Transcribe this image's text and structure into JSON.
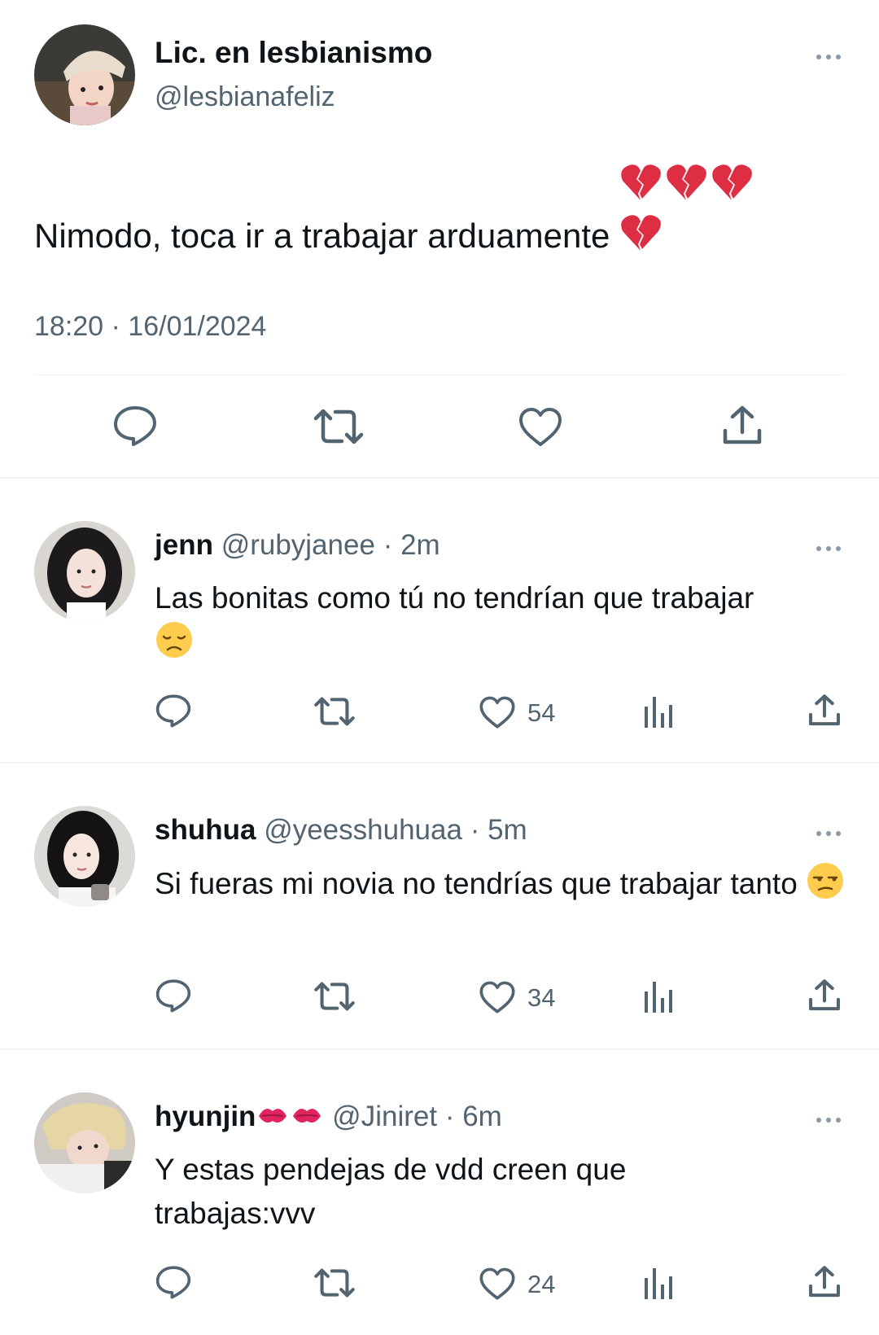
{
  "main_tweet": {
    "display_name": "Lic. en lesbianismo",
    "handle": "@lesbianafeliz",
    "text": "Nimodo, toca ir a trabajar arduamente",
    "emoji": "broken-heart x4",
    "timestamp": "18:20 · 16/01/2024",
    "actions": [
      "reply-icon",
      "retweet-icon",
      "like-icon",
      "share-icon"
    ]
  },
  "replies": [
    {
      "display_name": "jenn",
      "handle": "@rubyjanee",
      "time": "· 2m",
      "text": "Las bonitas como tú no tendrían que trabajar",
      "emoji": "disappointed-face",
      "likes": "54"
    },
    {
      "display_name": "shuhua",
      "handle": "@yeesshuhuaa",
      "time": "· 5m",
      "text": "Si fueras mi novia no tendrías que trabajar tanto",
      "emoji": "unamused-face",
      "likes": "34"
    },
    {
      "display_name": "hyunjin",
      "name_emoji": "kiss-mark x2",
      "handle": "@Jiniret",
      "time": "· 6m",
      "text": "Y estas pendejas de vdd creen que trabajas:vvv",
      "likes": "24"
    }
  ],
  "colors": {
    "text": "#0f1419",
    "secondary": "#536471",
    "icon": "#536471",
    "divider": "#eff3f4",
    "broken_heart": "#dd2e44"
  }
}
